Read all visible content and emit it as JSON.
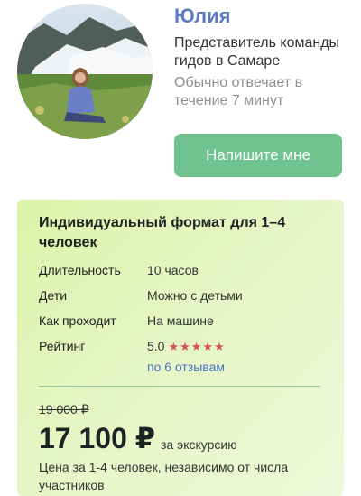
{
  "guide": {
    "name": "Юлия",
    "role": "Представитель команды гидов в Самаре",
    "reply_time": "Обычно отвечает в течение 7 минут",
    "contact_label": "Напишите мне"
  },
  "offer": {
    "title": "Индивидуальный формат для 1–4 человек",
    "details": [
      {
        "key": "Длительность",
        "value": "10 часов"
      },
      {
        "key": "Дети",
        "value": "Можно с детьми"
      },
      {
        "key": "Как проходит",
        "value": "На машине"
      },
      {
        "key": "Рейтинг",
        "value": "5.0"
      }
    ],
    "rating_stars": "★★★★★",
    "rating_value": 5,
    "reviews_link": "по 6 отзывам",
    "old_price": "19 000 ₽",
    "price": "17 100 ₽",
    "price_unit": "за экскурсию",
    "price_note": "Цена за 1-4 человек, независимо от числа участников"
  },
  "colors": {
    "accent_name": "#5c79c4",
    "button": "#6fc38f",
    "stars": "#d2505f",
    "link": "#4a73c8"
  }
}
